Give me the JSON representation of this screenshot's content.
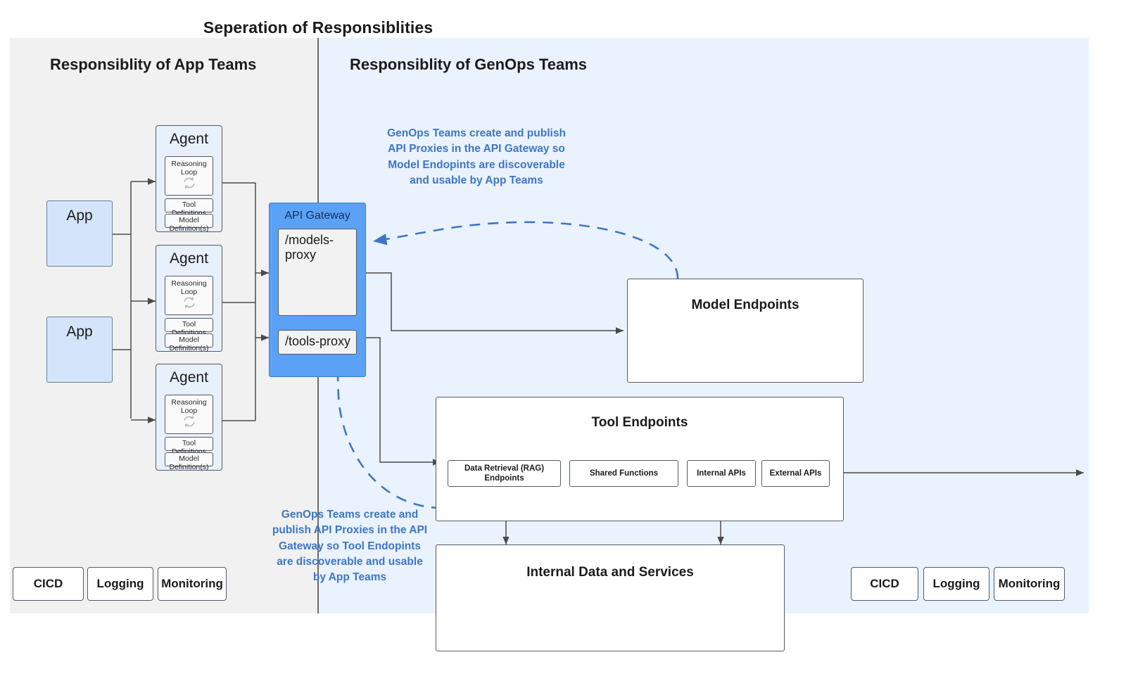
{
  "diagram": {
    "title": "Seperation of Responsiblities",
    "panels": {
      "left": {
        "heading": "Responsiblity of App Teams",
        "bg_color": "#f1f1f1"
      },
      "right": {
        "heading": "Responsiblity of GenOps Teams",
        "bg_color": "#eaf2fd"
      }
    },
    "colors": {
      "accent_blue": "#5ba1f5",
      "annotation_blue": "#3d77c2",
      "app_box_fill": "#d4e4fa",
      "agent_box_fill": "#e8f0fc",
      "border": "#555c66"
    }
  },
  "apps": [
    {
      "label": "App"
    },
    {
      "label": "App"
    }
  ],
  "agents": [
    {
      "title": "Agent",
      "reasoning_loop_label": "Reasoning Loop",
      "reasoning_loop_icon": "refresh-cycle-icon",
      "tool_definitions_label": "Tool Definitions",
      "model_definitions_label": "Model Definition(s)"
    },
    {
      "title": "Agent",
      "reasoning_loop_label": "Reasoning Loop",
      "reasoning_loop_icon": "refresh-cycle-icon",
      "tool_definitions_label": "Tool Definitions",
      "model_definitions_label": "Model Definition(s)"
    },
    {
      "title": "Agent",
      "reasoning_loop_label": "Reasoning Loop",
      "reasoning_loop_icon": "refresh-cycle-icon",
      "tool_definitions_label": "Tool Definitions",
      "model_definitions_label": "Model Definition(s)"
    }
  ],
  "api_gateway": {
    "title": "API Gateway",
    "models_proxy": "/models-proxy",
    "tools_proxy": "/tools-proxy"
  },
  "model_endpoints": {
    "title": "Model Endpoints"
  },
  "tool_endpoints": {
    "title": "Tool Endpoints",
    "chips": [
      "Data Retrieval (RAG) Endpoints",
      "Shared Functions",
      "Internal APIs",
      "External APIs"
    ]
  },
  "internal_data": {
    "title": "Internal Data and Services"
  },
  "annotations": {
    "models": "GenOps Teams create and publish\nAPI Proxies in the API Gateway so\nModel Endopints are discoverable\nand usable by App Teams",
    "tools": "GenOps Teams create and\npublish API Proxies in the API\nGateway so Tool Endopints\nare discoverable and usable\nby App Teams"
  },
  "ops_left": [
    {
      "label": "CICD"
    },
    {
      "label": "Logging"
    },
    {
      "label": "Monitoring"
    }
  ],
  "ops_right": [
    {
      "label": "CICD"
    },
    {
      "label": "Logging"
    },
    {
      "label": "Monitoring"
    }
  ]
}
